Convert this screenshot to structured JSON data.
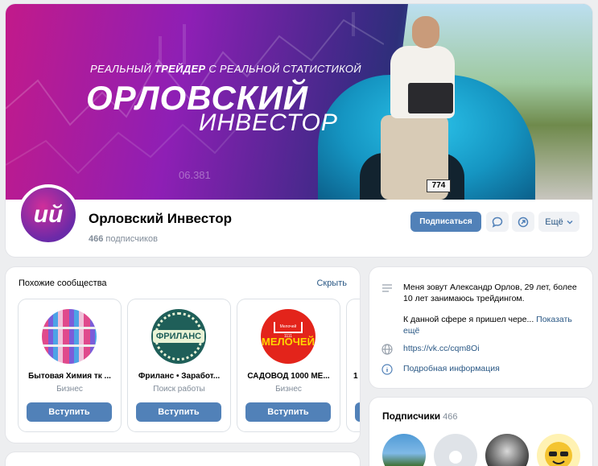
{
  "cover": {
    "tagline_prefix": "РЕАЛЬНЫЙ",
    "tagline_bold": "ТРЕЙДЕР",
    "tagline_suffix": "С РЕАЛЬНОЙ СТАТИСТИКОЙ",
    "title_line1": "ОРЛОВСКИЙ",
    "title_line2": "ИНВЕСТОР",
    "ticker_number": "06.381",
    "plate": "774"
  },
  "avatar_letters": "ий",
  "group": {
    "name": "Орловский Инвестор",
    "subscribers_count": "466",
    "subscribers_label": "подписчиков"
  },
  "actions": {
    "subscribe": "Подписаться",
    "more": "Ещё"
  },
  "similar": {
    "title": "Похожие сообщества",
    "hide": "Скрыть",
    "items": [
      {
        "name": "Бытовая Химия тк ...",
        "category": "Бизнес",
        "join": "Вступить"
      },
      {
        "name": "Фриланс • Заработ...",
        "category": "Поиск работы",
        "join": "Вступить",
        "logo_text": "ФРИЛАНС"
      },
      {
        "name": "САДОВОД 1000 МЕ...",
        "category": "Бизнес",
        "join": "Вступить",
        "logo_text": "МЕЛОЧЕЙ",
        "logo_small": "Мелочей 1111"
      },
      {
        "name": "1",
        "category": "",
        "join": ""
      }
    ]
  },
  "about": {
    "description": "Меня зовут Александр Орлов, 29 лет, более 10 лет занимаюсь трейдингом.",
    "more_text": "К данной сфере я пришел чере...",
    "show_more": "Показать ещё",
    "url": "https://vk.cc/cqm8Oi",
    "details": "Подробная информация"
  },
  "subscribers": {
    "title": "Подписчики",
    "count": "466"
  },
  "colors": {
    "accent": "#5181b8",
    "link": "#2a5885",
    "muted": "#818c99",
    "background": "#edeef0"
  }
}
